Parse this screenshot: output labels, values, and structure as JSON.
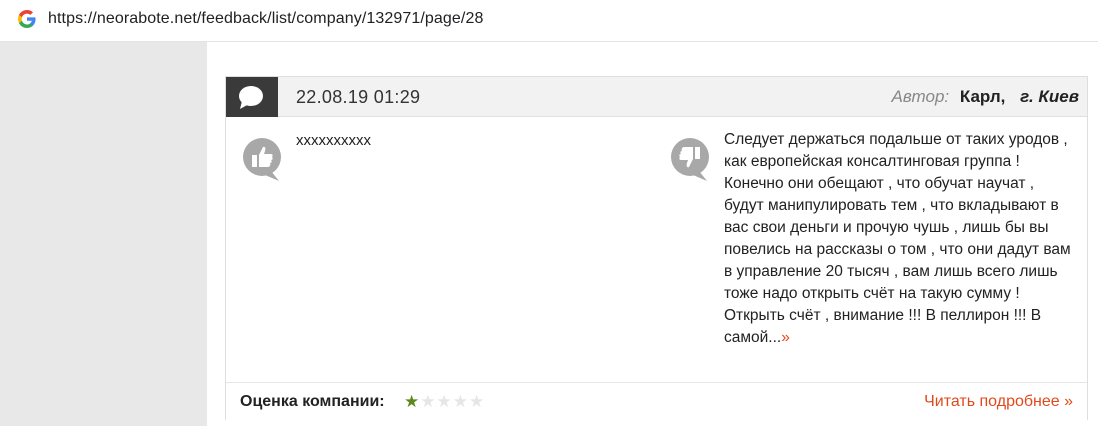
{
  "browser": {
    "url": "https://neorabote.net/feedback/list/company/132971/page/28"
  },
  "review": {
    "date": "22.08.19 01:29",
    "author_label": "Автор:",
    "author_name": "Карл,",
    "author_city": "г. Киев",
    "pros_text": "xxxxxxxxxx",
    "cons_text": "Следует держаться подальше от таких уродов , как европейская консалтинговая группа ! Конечно они обещают , что обучат научат , будут манипулировать тем , что вкладывают в вас свои деньги и прочую чушь , лишь бы вы повелись на рассказы о том , что они дадут вам в управление 20 тысяч , вам лишь всего лишь тоже надо открыть счёт на такую сумму ! Открыть счёт , внимание !!! В пеллирон !!! В самой...",
    "cons_more": "»",
    "rating_label": "Оценка компании:",
    "rating": 1,
    "rating_max": 5,
    "read_more": "Читать подробнее »"
  },
  "colors": {
    "accent": "#e04a1b",
    "star_active": "#5a8a1c",
    "header_dark": "#3a3a3a"
  },
  "icons": [
    "google-icon",
    "comment-bubble-icon",
    "thumbs-up-icon",
    "thumbs-down-icon",
    "star-icon"
  ]
}
